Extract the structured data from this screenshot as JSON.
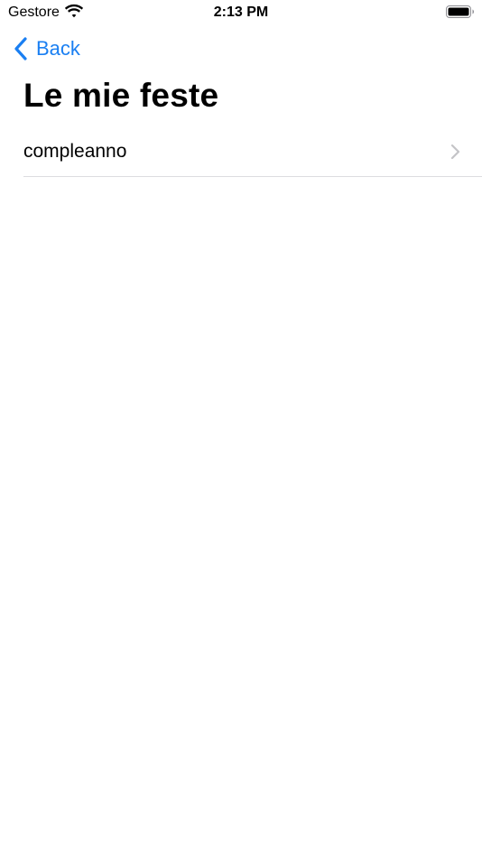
{
  "status_bar": {
    "carrier": "Gestore",
    "time": "2:13 PM",
    "icons": [
      "wifi-icon",
      "battery-icon"
    ]
  },
  "nav": {
    "back_label": "Back",
    "back_icon": "chevron-left-icon"
  },
  "page": {
    "title": "Le mie feste"
  },
  "list": {
    "items": [
      {
        "label": "compleanno",
        "icon": "chevron-right-icon"
      }
    ]
  },
  "colors": {
    "accent": "#1a7ff2",
    "separator": "#dcdce0",
    "chevron": "#c4c4c7"
  }
}
